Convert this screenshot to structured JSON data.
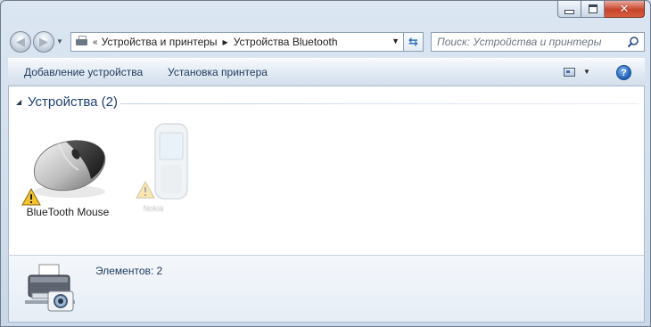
{
  "window": {
    "caption": {
      "minimize": "minimize-icon",
      "maximize": "maximize-icon",
      "close": "close-icon"
    }
  },
  "nav": {
    "back_icon": "back-arrow-icon",
    "forward_icon": "forward-arrow-icon",
    "address": {
      "overflow": "«",
      "segments": [
        "Устройства и принтеры",
        "Устройства Bluetooth"
      ]
    },
    "search": {
      "placeholder": "Поиск: Устройства и принтеры"
    }
  },
  "commandbar": {
    "add_device": "Добавление устройства",
    "install_printer": "Установка принтера",
    "help": "?"
  },
  "content": {
    "group": {
      "title": "Устройства (2)"
    },
    "devices": [
      {
        "name": "BlueTooth Mouse",
        "icon": "mouse-icon",
        "status": "warning-icon"
      },
      {
        "name": "Nokia",
        "icon": "phone-icon",
        "status": "warning-icon"
      }
    ]
  },
  "details": {
    "count_text": "Элементов: 2",
    "icon": "printer-camera-icon"
  },
  "colors": {
    "accent": "#1e3f7a",
    "close": "#c7432b",
    "warning": "#f2c230"
  }
}
